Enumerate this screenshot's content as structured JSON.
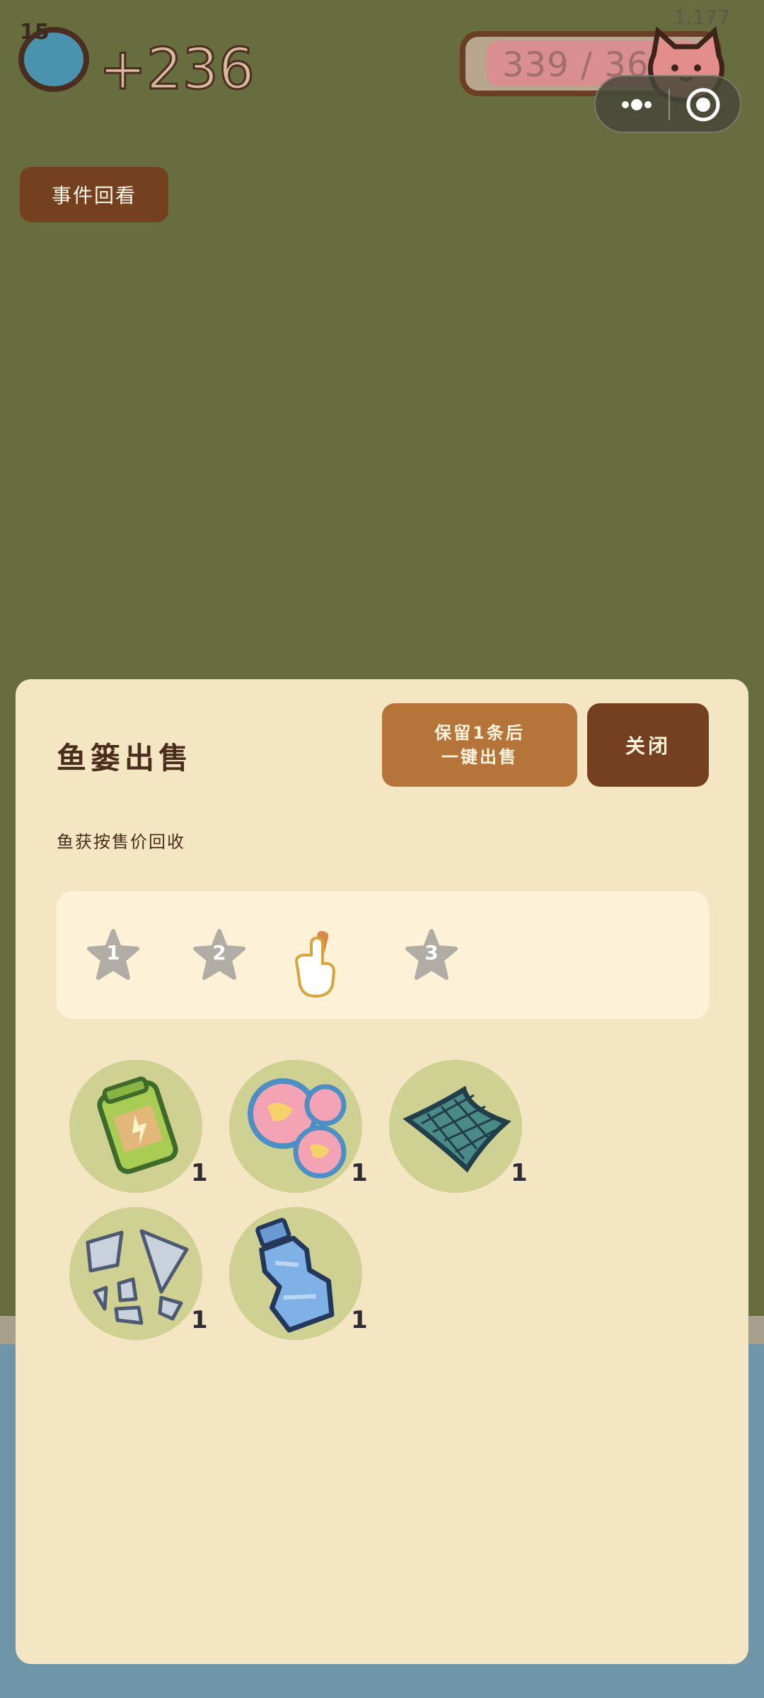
{
  "hud": {
    "level": "15",
    "score": "+236",
    "capacity": "339 / 365",
    "version": "1.177"
  },
  "miniprogram": {
    "more_icon": "more-dots-icon",
    "close_icon": "target-icon"
  },
  "event_button": {
    "label": "事件回看"
  },
  "panel": {
    "title": "鱼篓出售",
    "keep_sell_label_line1": "保留1条后",
    "keep_sell_label_line2": "一键出售",
    "close_label": "关闭",
    "subtitle": "鱼获按售价回收",
    "stars": [
      {
        "label": "1"
      },
      {
        "label": "2"
      },
      {
        "label": "3"
      }
    ],
    "items": [
      {
        "name": "battery",
        "count": "1"
      },
      {
        "name": "bubbles",
        "count": "1"
      },
      {
        "name": "fishing-net",
        "count": "1"
      },
      {
        "name": "broken-glass",
        "count": "1"
      },
      {
        "name": "crushed-bottle",
        "count": "1"
      }
    ]
  },
  "colors": {
    "background": "#676d3f",
    "panel": "#f4e6c2",
    "primary_button": "#b5753a",
    "dark_button": "#75401f",
    "item_circle": "#cfd193"
  }
}
